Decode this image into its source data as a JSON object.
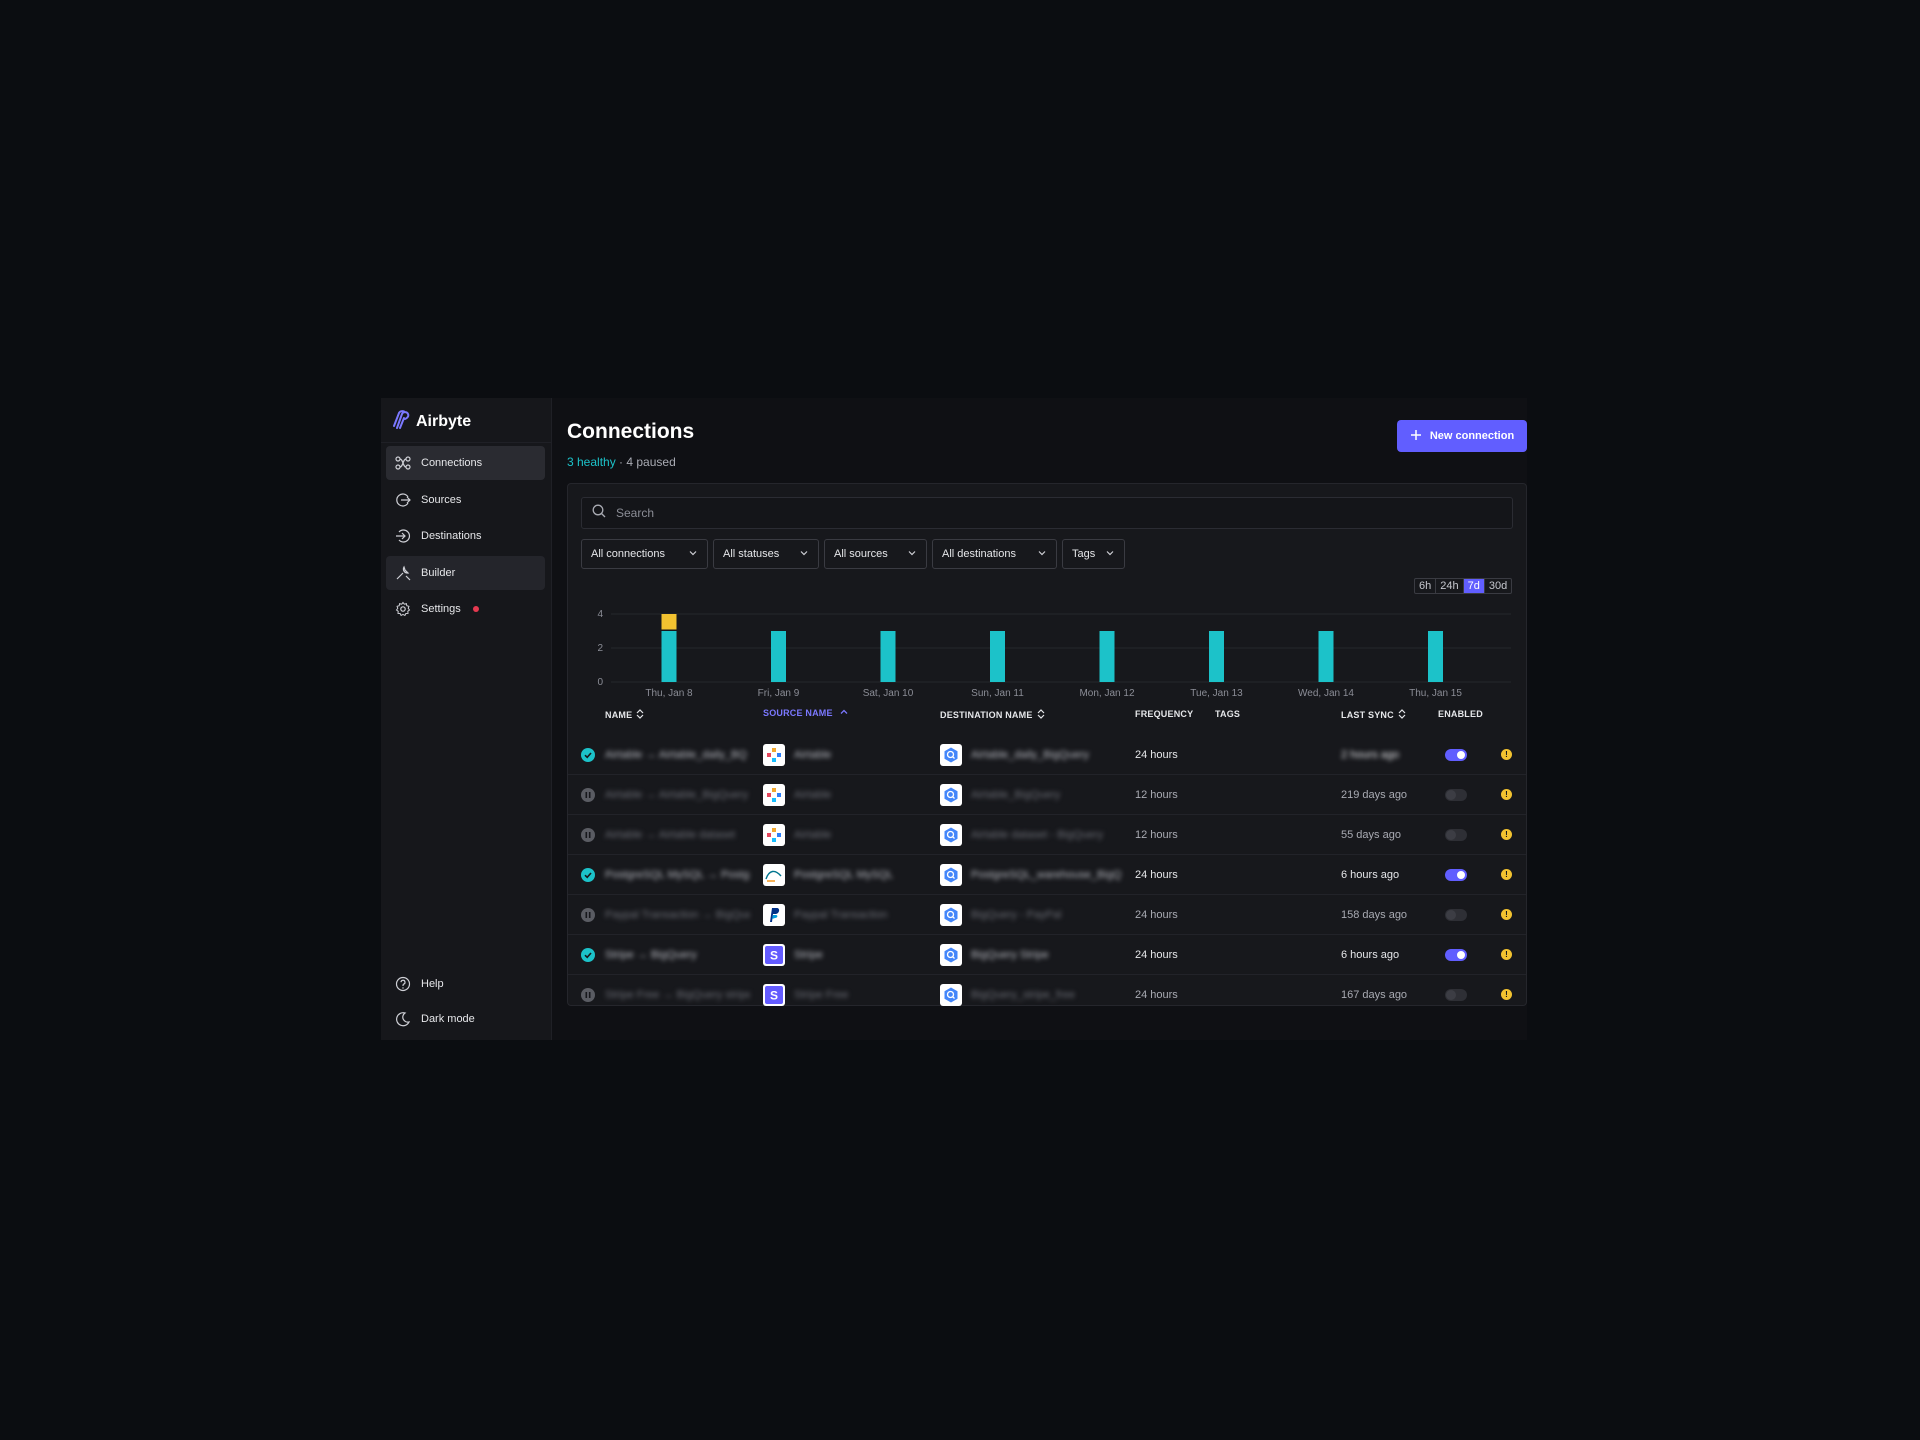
{
  "app": {
    "name": "Airbyte"
  },
  "sidebar": {
    "items": [
      {
        "label": "Connections",
        "icon": "connections-icon"
      },
      {
        "label": "Sources",
        "icon": "sources-icon"
      },
      {
        "label": "Destinations",
        "icon": "destinations-icon"
      },
      {
        "label": "Builder",
        "icon": "builder-icon"
      },
      {
        "label": "Settings",
        "icon": "gear-icon"
      }
    ],
    "footer": [
      {
        "label": "Help",
        "icon": "help-icon"
      },
      {
        "label": "Dark mode",
        "icon": "moon-icon"
      }
    ]
  },
  "header": {
    "title": "Connections",
    "healthy": "3 healthy",
    "separator": " · ",
    "paused": "4 paused",
    "new_button": "New connection"
  },
  "search": {
    "placeholder": "Search"
  },
  "filters": [
    "All connections",
    "All statuses",
    "All sources",
    "All destinations",
    "Tags"
  ],
  "time_range": {
    "options": [
      "6h",
      "24h",
      "7d",
      "30d"
    ],
    "selected": "7d"
  },
  "colors": {
    "accent": "#615eff",
    "healthy": "#1cc2c9",
    "warning": "#f2c230",
    "danger": "#e53950"
  },
  "chart_data": {
    "type": "bar",
    "categories": [
      "Thu, Jan 8",
      "Fri, Jan 9",
      "Sat, Jan 10",
      "Sun, Jan 11",
      "Mon, Jan 12",
      "Tue, Jan 13",
      "Wed, Jan 14",
      "Thu, Jan 15"
    ],
    "series": [
      {
        "values": [
          3,
          3,
          3,
          3,
          3,
          3,
          3,
          3
        ],
        "color": "#1cc2c9"
      },
      {
        "values": [
          1,
          0,
          0,
          0,
          0,
          0,
          0,
          0
        ],
        "color": "#f2c230"
      }
    ],
    "stacked": true,
    "yticks": [
      0,
      2,
      4
    ],
    "ylim": [
      0,
      4
    ],
    "grid": true
  },
  "table": {
    "columns": [
      {
        "label": "NAME",
        "sortable": true
      },
      {
        "label": "SOURCE NAME",
        "sortable": true,
        "sorted": "asc"
      },
      {
        "label": "DESTINATION NAME",
        "sortable": true
      },
      {
        "label": "FREQUENCY"
      },
      {
        "label": "TAGS"
      },
      {
        "label": "LAST SYNC",
        "sortable": true
      },
      {
        "label": "ENABLED"
      }
    ],
    "rows": [
      {
        "status": "healthy",
        "name": "Airtable → Airtable_daily_BQ",
        "source": "Airtable",
        "source_logo": "airtable",
        "destination": "Airtable_daily_BigQuery",
        "frequency": "24 hours",
        "last_sync": "2 hours ago",
        "enabled": true
      },
      {
        "status": "paused",
        "name": "Airtable → Airtable_BigQuery",
        "source": "Airtable",
        "destination": "Airtable_BigQuery",
        "source_logo": "airtable",
        "frequency": "12 hours",
        "last_sync": "219 days ago",
        "enabled": false
      },
      {
        "status": "paused",
        "name": "Airtable → Airtable dataset",
        "source": "Airtable",
        "destination": "Airtable dataset - BigQuery",
        "source_logo": "airtable",
        "frequency": "12 hours",
        "last_sync": "55 days ago",
        "enabled": false
      },
      {
        "status": "healthy",
        "name": "PostgreSQL MySQL → Postgres",
        "source": "PostgreSQL MySQL",
        "destination": "PostgreSQL_warehouse_BigQuery",
        "source_logo": "mysql",
        "frequency": "24 hours",
        "last_sync": "6 hours ago",
        "enabled": true
      },
      {
        "status": "paused",
        "name": "Paypal Transaction → BigQuery",
        "source": "Paypal Transaction",
        "destination": "BigQuery - PayPal",
        "source_logo": "paypal",
        "frequency": "24 hours",
        "last_sync": "158 days ago",
        "enabled": false
      },
      {
        "status": "healthy",
        "name": "Stripe → BigQuery",
        "source": "Stripe",
        "destination": "BigQuery Stripe",
        "source_logo": "stripe",
        "frequency": "24 hours",
        "last_sync": "6 hours ago",
        "enabled": true
      },
      {
        "status": "paused",
        "name": "Stripe Free → BigQuery stripe",
        "source": "Stripe Free",
        "destination": "BigQuery_stripe_free",
        "source_logo": "stripe",
        "frequency": "24 hours",
        "last_sync": "167 days ago",
        "enabled": false
      }
    ]
  }
}
